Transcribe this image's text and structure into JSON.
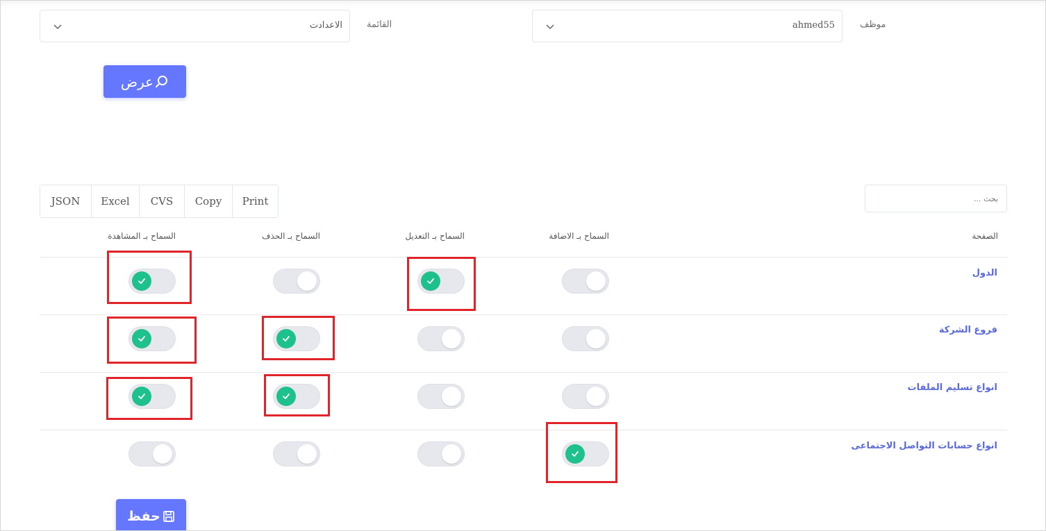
{
  "filters": {
    "employee_label": "موظف",
    "employee_value": "ahmed55",
    "menu_label": "القائمة",
    "menu_value": "الاعدادت"
  },
  "buttons": {
    "view_label": "عرض",
    "save_label": "حفظ"
  },
  "search": {
    "placeholder": "بحث ..."
  },
  "export_buttons": [
    "JSON",
    "Excel",
    "CVS",
    "Copy",
    "Print"
  ],
  "table": {
    "headers": {
      "page": "الصفحة",
      "allow_add": "السماح بـ الاضافة",
      "allow_edit": "السماح بـ التعديل",
      "allow_delete": "السماح بـ الحذف",
      "allow_view": "السماح بـ المشاهدة"
    },
    "rows": [
      {
        "page": "الدول",
        "add": false,
        "edit": true,
        "delete": false,
        "view": true
      },
      {
        "page": "فروع الشركة",
        "add": false,
        "edit": false,
        "delete": true,
        "view": true
      },
      {
        "page": "انواع تسليم الملفات",
        "add": false,
        "edit": false,
        "delete": true,
        "view": true
      },
      {
        "page": "انواع حسابات التواصل الاجتماعى",
        "add": true,
        "edit": false,
        "delete": false,
        "view": false
      }
    ]
  },
  "colors": {
    "accent": "#6576ff",
    "toggle_on": "#1ec08c",
    "highlight": "#e1232a",
    "link": "#5a6ad8"
  },
  "icons": {
    "view_button": "search-icon",
    "save_button": "save-icon",
    "select": "chevron-down-icon",
    "toggle_on": "check-icon"
  }
}
